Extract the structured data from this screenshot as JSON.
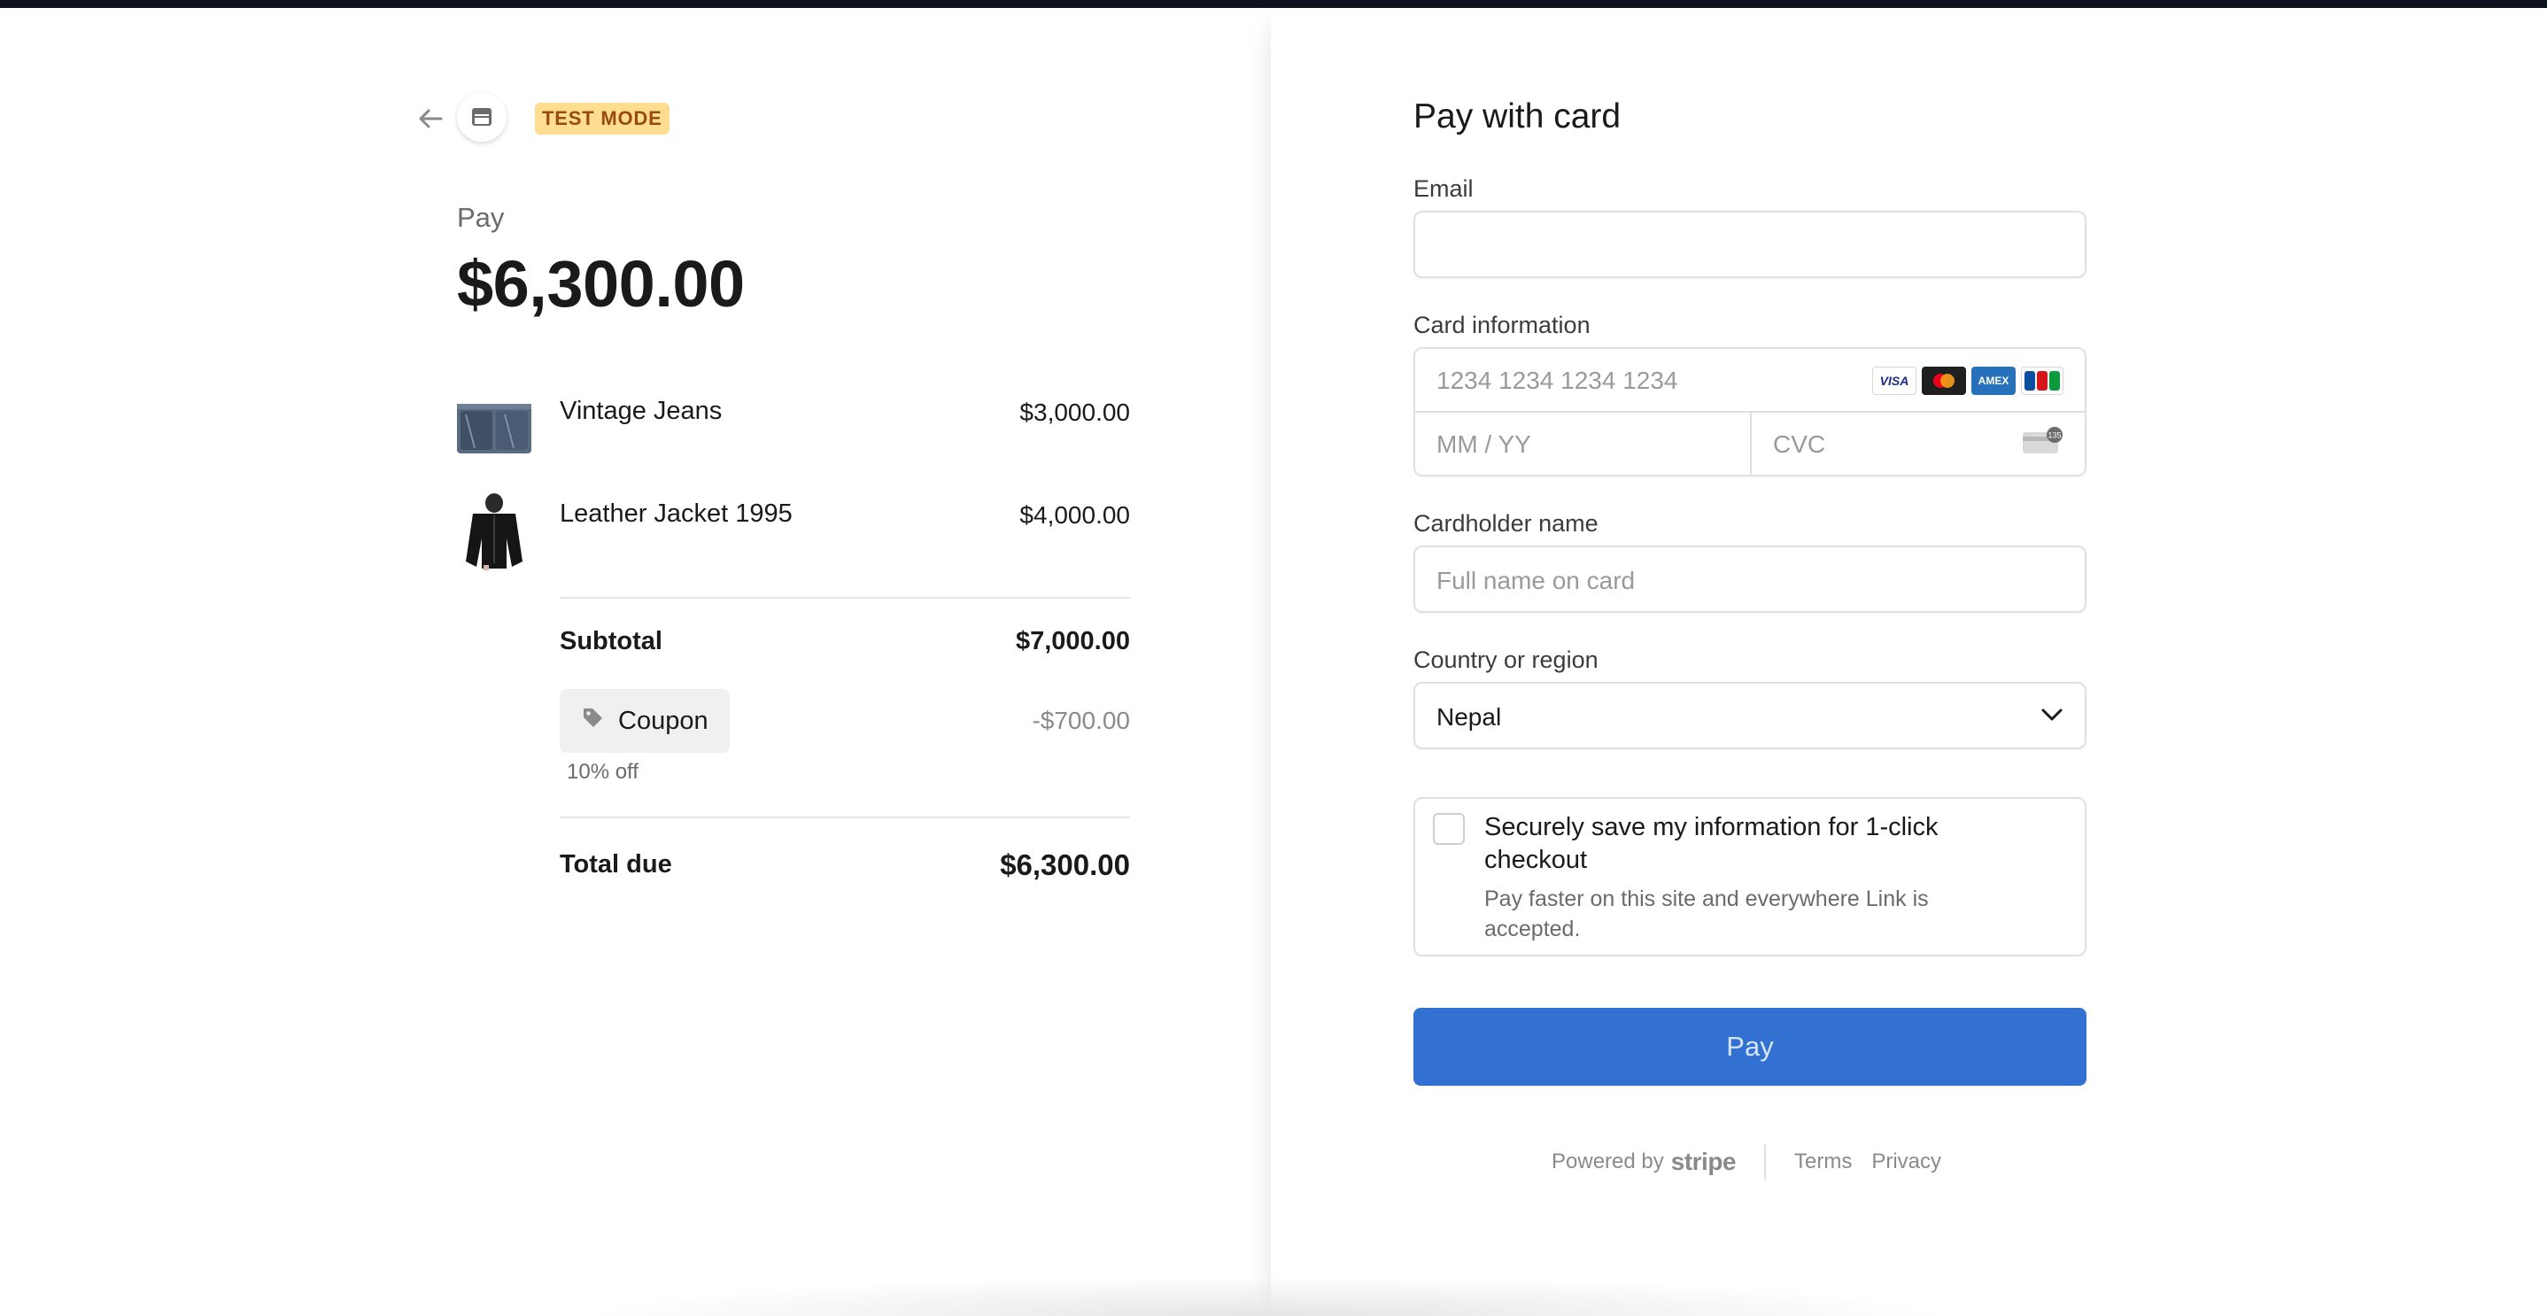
{
  "header": {
    "badge": "TEST MODE"
  },
  "summary": {
    "pay_label": "Pay",
    "amount": "$6,300.00",
    "items": [
      {
        "name": "Vintage Jeans",
        "price": "$3,000.00",
        "thumb": "jeans-thumbnail"
      },
      {
        "name": "Leather Jacket 1995",
        "price": "$4,000.00",
        "thumb": "jacket-thumbnail"
      }
    ],
    "subtotal_label": "Subtotal",
    "subtotal_value": "$7,000.00",
    "coupon_label": "Coupon",
    "coupon_value": "-$700.00",
    "coupon_note": "10% off",
    "total_label": "Total due",
    "total_value": "$6,300.00"
  },
  "form": {
    "title": "Pay with card",
    "email_label": "Email",
    "email_value": "",
    "card_label": "Card information",
    "card_number_placeholder": "1234 1234 1234 1234",
    "expiry_placeholder": "MM / YY",
    "cvc_placeholder": "CVC",
    "card_brands": [
      "VISA",
      "mastercard",
      "AMEX",
      "JCB"
    ],
    "cvc_hint": "135",
    "name_label": "Cardholder name",
    "name_placeholder": "Full name on card",
    "country_label": "Country or region",
    "country_value": "Nepal",
    "save_title": "Securely save my information for 1-click checkout",
    "save_desc": "Pay faster on this site and everywhere Link is accepted.",
    "pay_button": "Pay"
  },
  "footer": {
    "powered_by": "Powered by",
    "brand": "stripe",
    "terms": "Terms",
    "privacy": "Privacy"
  },
  "colors": {
    "pay_button": "#3271d1",
    "badge_bg": "#ffde92",
    "badge_text": "#9b4a0d"
  }
}
